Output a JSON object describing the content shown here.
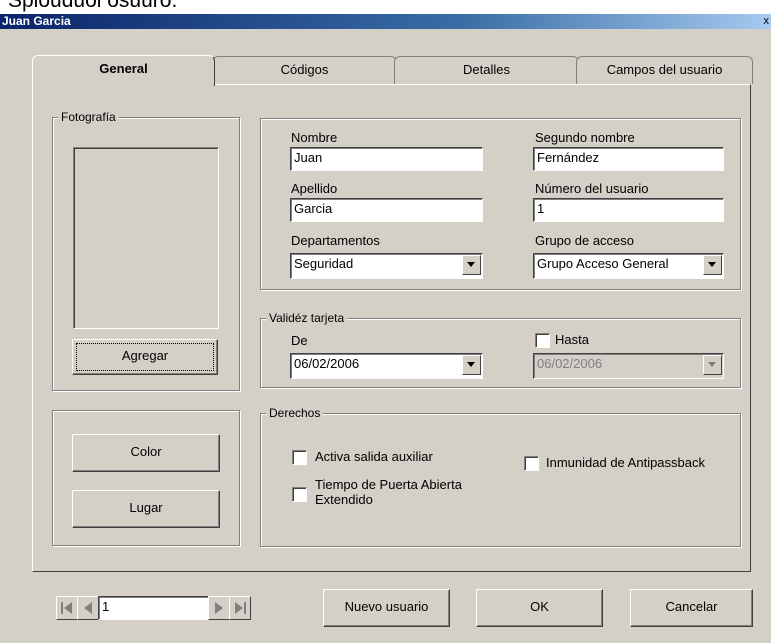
{
  "window": {
    "title": "Juan Garcia",
    "top_text": "Spiouduoi osuuro."
  },
  "tabs": [
    {
      "label": "General",
      "active": true
    },
    {
      "label": "Códigos",
      "active": false
    },
    {
      "label": "Detalles",
      "active": false
    },
    {
      "label": "Campos del usuario",
      "active": false
    }
  ],
  "photo": {
    "legend": "Fotografía",
    "add_label": "Agregar"
  },
  "side_buttons": {
    "color_label": "Color",
    "place_label": "Lugar"
  },
  "user": {
    "first_name_label": "Nombre",
    "first_name_value": "Juan",
    "middle_name_label": "Segundo nombre",
    "middle_name_value": "Fernández",
    "last_name_label": "Apellido",
    "last_name_value": "Garcia",
    "user_number_label": "Número del usuario",
    "user_number_value": "1",
    "department_label": "Departamentos",
    "department_value": "Seguridad",
    "access_group_label": "Grupo de acceso",
    "access_group_value": "Grupo Acceso General"
  },
  "validity": {
    "legend": "Validéz tarjeta",
    "from_label": "De",
    "from_value": "06/02/2006",
    "until_label": "Hasta",
    "until_value": "06/02/2006",
    "until_checked": false
  },
  "rights": {
    "legend": "Derechos",
    "aux_exit_label": "Activa salida auxiliar",
    "door_open_label_1": "Tiempo de Puerta Abierta",
    "door_open_label_2": "Extendido",
    "antipassback_label": "Inmunidad de Antipassback"
  },
  "footer": {
    "record_value": "1",
    "new_user_label": "Nuevo usuario",
    "ok_label": "OK",
    "cancel_label": "Cancelar"
  }
}
